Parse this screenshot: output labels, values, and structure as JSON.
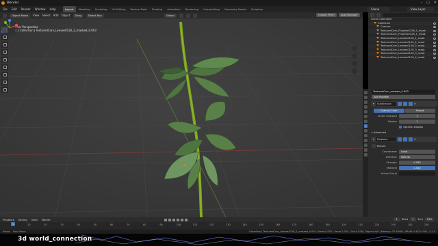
{
  "window": {
    "title": "Blender"
  },
  "menu": {
    "items": [
      "File",
      "Edit",
      "Render",
      "Window",
      "Help"
    ],
    "workspaces": [
      "Layout",
      "Modeling",
      "Sculpting",
      "UV Editing",
      "Texture Paint",
      "Shading",
      "Animation",
      "Rendering",
      "Compositing",
      "Geometry Nodes",
      "Scripting"
    ],
    "active_workspace": "Layout",
    "scene": "Scene",
    "view_layer": "View Layer"
  },
  "tool_header": {
    "mode": "Object Mode",
    "menus": [
      "View",
      "Select",
      "Add",
      "Object"
    ],
    "drag": "Drag",
    "select_box": "Select Box",
    "transform": "Global",
    "right_buttons": [
      "Invoke Prem",
      "App Manager"
    ]
  },
  "view_header": {
    "orientation": "Orientation:",
    "orientation_value": "Default",
    "obj_label": "ReloadTree 3.1.8 (sdf)"
  },
  "viewport": {
    "perspective": "User Perspective",
    "collection": "(1) Collection | TexturedCorn_Leaves0126_2_masked_0.003",
    "options": "Options"
  },
  "outliner": {
    "root": "Scene Collection",
    "collection": "Collection",
    "items": [
      "Camera",
      "TexturedCorn_Flowers0126_1_mask",
      "TexturedCorn_Flowers0126_1_mask",
      "TexturedCorn_Leaves0126_1_mask",
      "TexturedCorn_Leaves0126_2_mask",
      "TexturedCorn_Leaves0126_2_mask",
      "TexturedCorn_Leaves0126_3_mask",
      "TexturedCorn_Leaves0126_3_mask",
      "TexturedCorn_Leaves0126_4_mask"
    ]
  },
  "properties": {
    "object_name": "TexturedCorn_masked_0.003",
    "add_modifier": "Add Modifier",
    "subsurf": {
      "name": "Subdivision",
      "tabs": [
        "Catmull-Clark",
        "Simple"
      ],
      "levels_viewport_label": "Levels Viewport",
      "levels_viewport": "1",
      "render_label": "Render",
      "render": "1",
      "optimal_display": "Optimal Display",
      "advanced": "Advanced"
    },
    "displace": {
      "name": "Displace",
      "texture_label": "Texture",
      "coordinates_label": "Coordinates",
      "coordinates": "Local",
      "direction_label": "Direction",
      "direction": "Normal",
      "strength_label": "Strength",
      "strength": "0.180",
      "midlevel_label": "Midlevel",
      "midlevel": "0.500",
      "vertex_group_label": "Vertex Group"
    }
  },
  "timeline": {
    "menus": [
      "Playback",
      "Keying",
      "View",
      "Marker"
    ],
    "current_frame": "1",
    "ticks": [
      "10",
      "20",
      "30",
      "40",
      "50",
      "60",
      "70",
      "80",
      "90",
      "100",
      "110",
      "120",
      "130",
      "140",
      "150",
      "160",
      "170",
      "180",
      "190",
      "200",
      "210",
      "220",
      "230",
      "240",
      "250"
    ],
    "start_label": "Start",
    "start": "1",
    "end_label": "End",
    "end": "250"
  },
  "statusbar": {
    "left": "Select",
    "mid": "Box Select",
    "right": "Collection | TexturedCorn_Leaves0126_2_masked_0.003 | Verts:0,052 | Faces:2,514 | Tris:5,028 | Objects:0/9 | Memory: 57.8 MiB | VRAM: 0.6/2.0 GiB | 3.1.0"
  },
  "watermark": {
    "text": "3d world_connection"
  },
  "colors": {
    "accent_orange": "#e87d0d",
    "accent_blue": "#4772b3",
    "viewport_bg": "#393939",
    "stem_green": "#7aa51f",
    "leaf_green": "#4e7440"
  }
}
